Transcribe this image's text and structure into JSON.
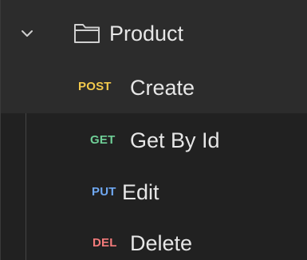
{
  "colors": {
    "background": "#212121",
    "row_highlight": "#2c2c2c",
    "text": "#e6e6e6",
    "post": "#f2c94c",
    "get": "#6fcf97",
    "put": "#6fa8f2",
    "del": "#f47b7b"
  },
  "collection": {
    "folder_icon": "folder-icon",
    "chevron_icon": "chevron-down-icon",
    "folder_name": "Product",
    "requests": [
      {
        "method": "POST",
        "name": "Create"
      },
      {
        "method": "GET",
        "name": "Get By Id"
      },
      {
        "method": "PUT",
        "name": "Edit"
      },
      {
        "method": "DEL",
        "name": "Delete"
      }
    ]
  }
}
